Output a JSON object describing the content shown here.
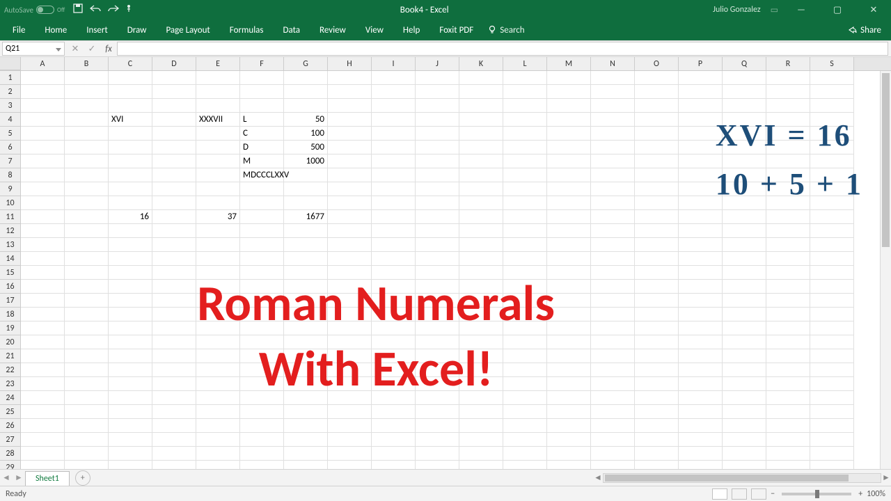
{
  "titlebar": {
    "autosave_label": "AutoSave",
    "autosave_state": "Off",
    "title": "Book4 - Excel",
    "user": "Julio Gonzalez"
  },
  "ribbon": {
    "tabs": [
      "File",
      "Home",
      "Insert",
      "Draw",
      "Page Layout",
      "Formulas",
      "Data",
      "Review",
      "View",
      "Help",
      "Foxit PDF"
    ],
    "search_label": "Search",
    "share_label": "Share"
  },
  "formula_bar": {
    "name_box": "Q21",
    "fx_label": "fx",
    "formula": ""
  },
  "columns": [
    "A",
    "B",
    "C",
    "D",
    "E",
    "F",
    "G",
    "H",
    "I",
    "J",
    "K",
    "L",
    "M",
    "N",
    "O",
    "P",
    "Q",
    "R",
    "S"
  ],
  "row_count": 29,
  "cells": {
    "C4": {
      "v": "XVI",
      "t": "txt"
    },
    "E4": {
      "v": "XXXVII",
      "t": "txt"
    },
    "F4": {
      "v": "L",
      "t": "txt"
    },
    "G4": {
      "v": "50",
      "t": "num"
    },
    "F5": {
      "v": "C",
      "t": "txt"
    },
    "G5": {
      "v": "100",
      "t": "num"
    },
    "F6": {
      "v": "D",
      "t": "txt"
    },
    "G6": {
      "v": "500",
      "t": "num"
    },
    "F7": {
      "v": "M",
      "t": "txt"
    },
    "G7": {
      "v": "1000",
      "t": "num"
    },
    "F8": {
      "v": "MDCCCLXXV",
      "t": "txt"
    },
    "C11": {
      "v": "16",
      "t": "num"
    },
    "E11": {
      "v": "37",
      "t": "num"
    },
    "G11": {
      "v": "1677",
      "t": "num"
    }
  },
  "overlay": {
    "line1": "Roman Numerals",
    "line2": "With Excel!"
  },
  "handwriting": {
    "line1": "XVI = 16",
    "line2": "10 + 5 + 1"
  },
  "sheets": {
    "active": "Sheet1"
  },
  "status": {
    "ready": "Ready",
    "zoom": "100%"
  }
}
